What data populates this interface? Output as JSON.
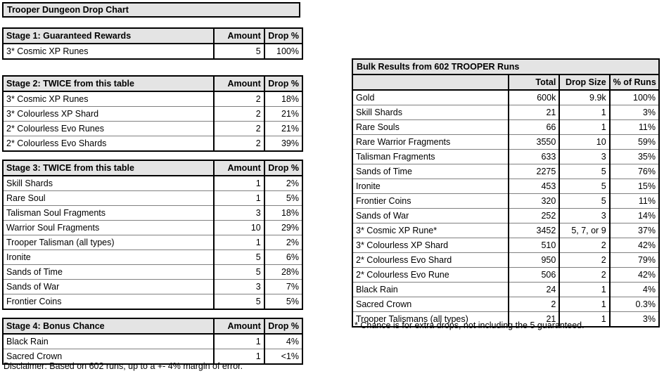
{
  "page": {
    "title": "Trooper Dungeon Drop Chart",
    "disclaimer": "Disclaimer: Based on 602 runs, up to a +- 4% margin of error."
  },
  "stage1": {
    "header": {
      "name": "Stage 1: Guaranteed Rewards",
      "amount": "Amount",
      "drop": "Drop %"
    },
    "rows": [
      {
        "name": "3* Cosmic XP Runes",
        "amount": "5",
        "drop": "100%"
      }
    ]
  },
  "stage2": {
    "header": {
      "name": "Stage 2: TWICE from this table",
      "amount": "Amount",
      "drop": "Drop %"
    },
    "rows": [
      {
        "name": "3* Cosmic XP Runes",
        "amount": "2",
        "drop": "18%"
      },
      {
        "name": "3* Colourless XP Shard",
        "amount": "2",
        "drop": "21%"
      },
      {
        "name": "2* Colourless Evo Runes",
        "amount": "2",
        "drop": "21%"
      },
      {
        "name": "2* Colourless Evo Shards",
        "amount": "2",
        "drop": "39%"
      }
    ]
  },
  "stage3": {
    "header": {
      "name": "Stage 3: TWICE from this table",
      "amount": "Amount",
      "drop": "Drop %"
    },
    "rows": [
      {
        "name": "Skill Shards",
        "amount": "1",
        "drop": "2%"
      },
      {
        "name": "Rare Soul",
        "amount": "1",
        "drop": "5%"
      },
      {
        "name": "Talisman Soul Fragments",
        "amount": "3",
        "drop": "18%"
      },
      {
        "name": "Warrior Soul Fragments",
        "amount": "10",
        "drop": "29%"
      },
      {
        "name": "Trooper Talisman (all types)",
        "amount": "1",
        "drop": "2%"
      },
      {
        "name": "Ironite",
        "amount": "5",
        "drop": "6%"
      },
      {
        "name": "Sands of Time",
        "amount": "5",
        "drop": "28%"
      },
      {
        "name": "Sands of War",
        "amount": "3",
        "drop": "7%"
      },
      {
        "name": "Frontier Coins",
        "amount": "5",
        "drop": "5%"
      }
    ]
  },
  "stage4": {
    "header": {
      "name": "Stage 4: Bonus Chance",
      "amount": "Amount",
      "drop": "Drop %"
    },
    "rows": [
      {
        "name": "Black Rain",
        "amount": "1",
        "drop": "4%"
      },
      {
        "name": "Sacred Crown",
        "amount": "1",
        "drop": "<1%"
      }
    ]
  },
  "bulk": {
    "title": "Bulk Results from 602 TROOPER Runs",
    "header": {
      "name": "",
      "total": "Total",
      "size": "Drop Size",
      "pct": "% of Runs"
    },
    "rows": [
      {
        "name": "Gold",
        "total": "600k",
        "size": "9.9k",
        "pct": "100%"
      },
      {
        "name": "Skill Shards",
        "total": "21",
        "size": "1",
        "pct": "3%"
      },
      {
        "name": "Rare Souls",
        "total": "66",
        "size": "1",
        "pct": "11%"
      },
      {
        "name": "Rare Warrior Fragments",
        "total": "3550",
        "size": "10",
        "pct": "59%"
      },
      {
        "name": "Talisman Fragments",
        "total": "633",
        "size": "3",
        "pct": "35%"
      },
      {
        "name": "Sands of Time",
        "total": "2275",
        "size": "5",
        "pct": "76%"
      },
      {
        "name": "Ironite",
        "total": "453",
        "size": "5",
        "pct": "15%"
      },
      {
        "name": "Frontier Coins",
        "total": "320",
        "size": "5",
        "pct": "11%"
      },
      {
        "name": "Sands of War",
        "total": "252",
        "size": "3",
        "pct": "14%"
      },
      {
        "name": "3* Cosmic XP Rune*",
        "total": "3452",
        "size": "5, 7, or 9",
        "pct": "37%"
      },
      {
        "name": "3* Colourless XP Shard",
        "total": "510",
        "size": "2",
        "pct": "42%"
      },
      {
        "name": "2* Colourless Evo Shard",
        "total": "950",
        "size": "2",
        "pct": "79%"
      },
      {
        "name": "2* Colourless Evo Rune",
        "total": "506",
        "size": "2",
        "pct": "42%"
      },
      {
        "name": "Black Rain",
        "total": "24",
        "size": "1",
        "pct": "4%"
      },
      {
        "name": "Sacred Crown",
        "total": "2",
        "size": "1",
        "pct": "0.3%"
      },
      {
        "name": "Trooper Talismans (all types)",
        "total": "21",
        "size": "1",
        "pct": "3%"
      }
    ],
    "footnote": "* Chance is for extra drops, not including the 5 guaranteed."
  },
  "colors": {
    "header_fill": "#e4e4e4",
    "border_outer": "#000000",
    "border_inner": "#808080",
    "page_background": "#ffffff"
  }
}
